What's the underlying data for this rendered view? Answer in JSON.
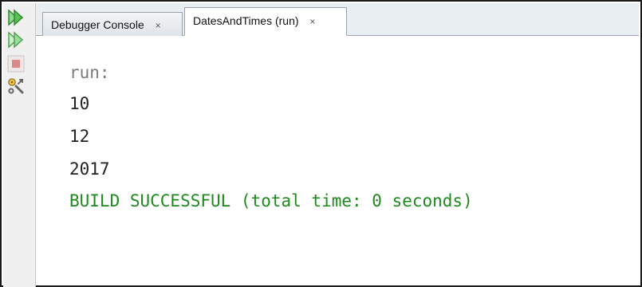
{
  "toolbar": {
    "icons": [
      "rerun-icon",
      "rerun-with-options-icon",
      "stop-icon",
      "settings-icon"
    ],
    "colors": {
      "run_green": "#2fa82f",
      "stop": "#d98b8b"
    }
  },
  "tabs": [
    {
      "label": "Debugger Console",
      "close": "×",
      "active": false
    },
    {
      "label": "DatesAndTimes (run)",
      "close": "×",
      "active": true
    }
  ],
  "console": {
    "lines": [
      {
        "text": "run:",
        "style": "muted"
      },
      {
        "text": "10",
        "style": "normal"
      },
      {
        "text": "12",
        "style": "normal"
      },
      {
        "text": "2017",
        "style": "normal"
      },
      {
        "text": "BUILD SUCCESSFUL (total time: 0 seconds)",
        "style": "success"
      }
    ],
    "colors": {
      "text": "#222222",
      "muted": "#7a7a7a",
      "success": "#1e8a1e"
    }
  }
}
